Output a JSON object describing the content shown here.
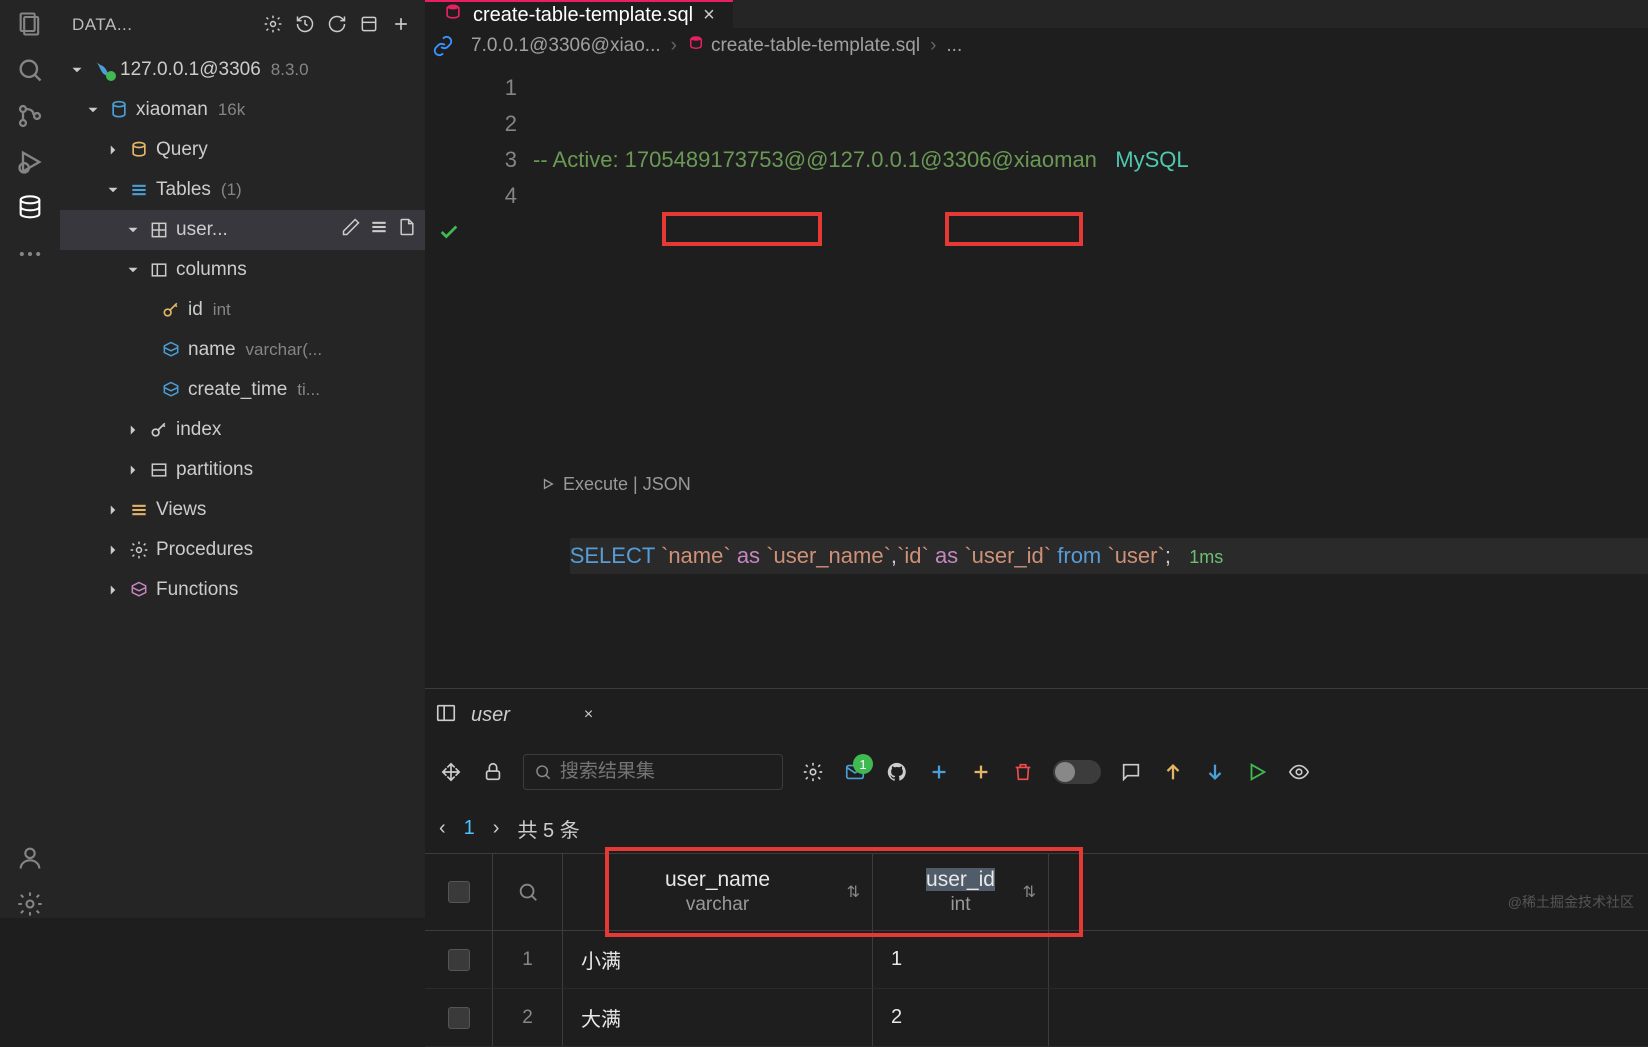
{
  "sidebar": {
    "title": "DATA...",
    "connection": {
      "host": "127.0.0.1@3306",
      "version": "8.3.0"
    },
    "database": {
      "name": "xiaoman",
      "count": "16k"
    },
    "folders": {
      "query": "Query",
      "tables": "Tables",
      "tables_count": "(1)",
      "views": "Views",
      "procedures": "Procedures",
      "functions": "Functions",
      "index": "index",
      "partitions": "partitions",
      "columns": "columns"
    },
    "table": {
      "name": "user..."
    },
    "columns": [
      {
        "name": "id",
        "type": "int",
        "pk": true
      },
      {
        "name": "name",
        "type": "varchar(...",
        "pk": false
      },
      {
        "name": "create_time",
        "type": "ti...",
        "pk": false
      }
    ]
  },
  "tab": {
    "filename": "create-table-template.sql"
  },
  "breadcrumb": {
    "segment1": "7.0.0.1@3306@xiao...",
    "segment2": "create-table-template.sql",
    "ellipsis": "..."
  },
  "editor": {
    "lines": [
      "1",
      "2",
      "3",
      "",
      "4"
    ],
    "comment_line": "-- Active: 1705489173753@@127.0.0.1@3306@xiaoman",
    "mysql_label": "MySQL",
    "codelens": "Execute | JSON",
    "select_kw": "SELECT",
    "as_kw": "as",
    "from_kw": "from",
    "bt_name": "`name`",
    "bt_user_name": "`user_name`",
    "bt_id": "`id`",
    "bt_user_id": "`user_id`",
    "bt_user": "`user`",
    "exec_time": "1ms"
  },
  "results": {
    "tab_label": "user",
    "search_placeholder": "搜索结果集",
    "mail_badge": "1",
    "page_current": "1",
    "total_label": "共 5 条",
    "columns": [
      {
        "name": "user_name",
        "type": "varchar"
      },
      {
        "name": "user_id",
        "type": "int"
      }
    ],
    "rows": [
      {
        "num": "1",
        "user_name": "小满",
        "user_id": "1"
      },
      {
        "num": "2",
        "user_name": "大满",
        "user_id": "2"
      }
    ]
  },
  "watermark": "@稀土掘金技术社区"
}
